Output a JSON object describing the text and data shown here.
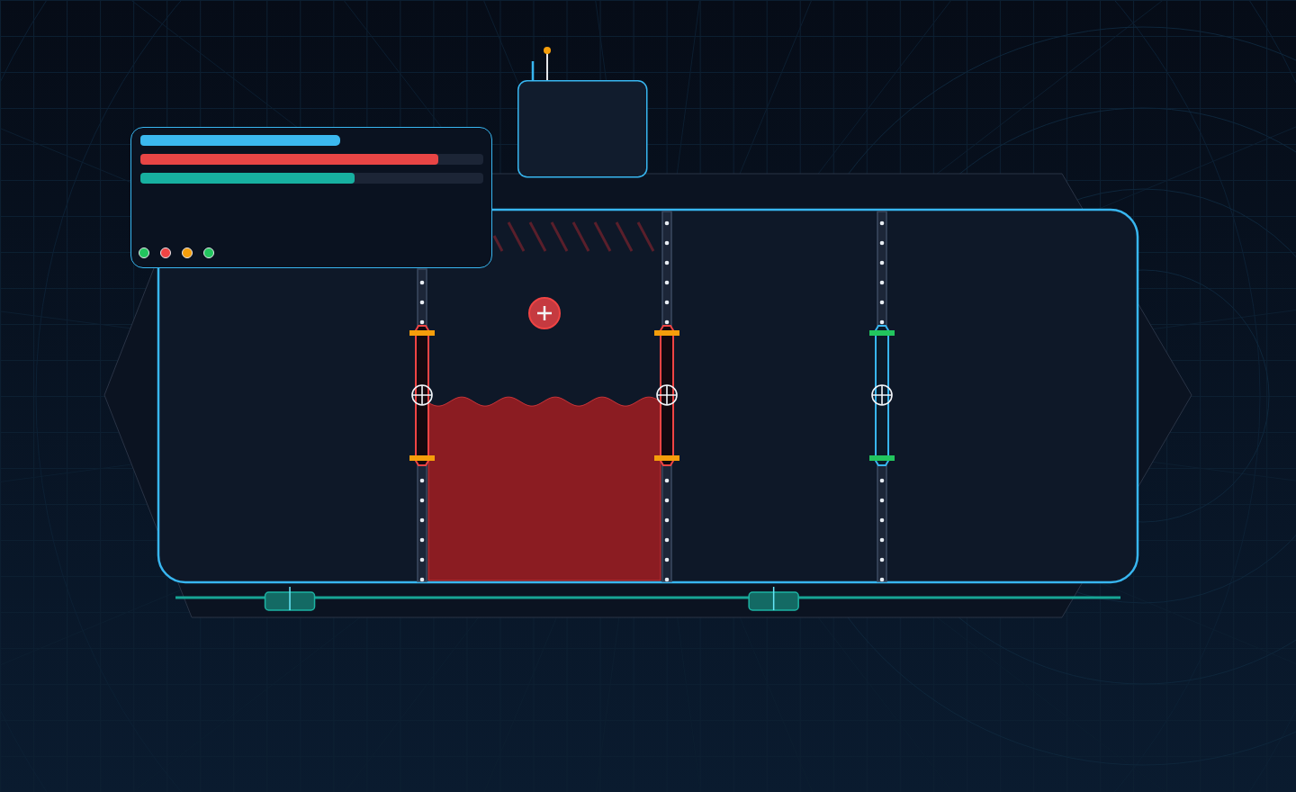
{
  "panel": {
    "gauges": [
      {
        "kind": "bar",
        "color": "#3bb8ef"
      },
      {
        "kind": "meter",
        "color": "#e84545",
        "level": 0.87
      },
      {
        "kind": "meter",
        "color": "#17b0a0",
        "level": 0.625
      }
    ],
    "indicators": [
      {
        "color": "#22c55e"
      },
      {
        "color": "#ef4444"
      },
      {
        "color": "#f59e0b"
      },
      {
        "color": "#22c55e"
      }
    ]
  },
  "tank": {
    "hazard": true,
    "add_button": true,
    "fluid": {
      "level": 0.485
    },
    "doors": [
      {
        "locked": true
      },
      {
        "locked": true
      },
      {
        "locked": false
      }
    ]
  },
  "rail": {
    "handles": [
      {
        "level": 0.121
      },
      {
        "level": 0.633
      }
    ]
  }
}
